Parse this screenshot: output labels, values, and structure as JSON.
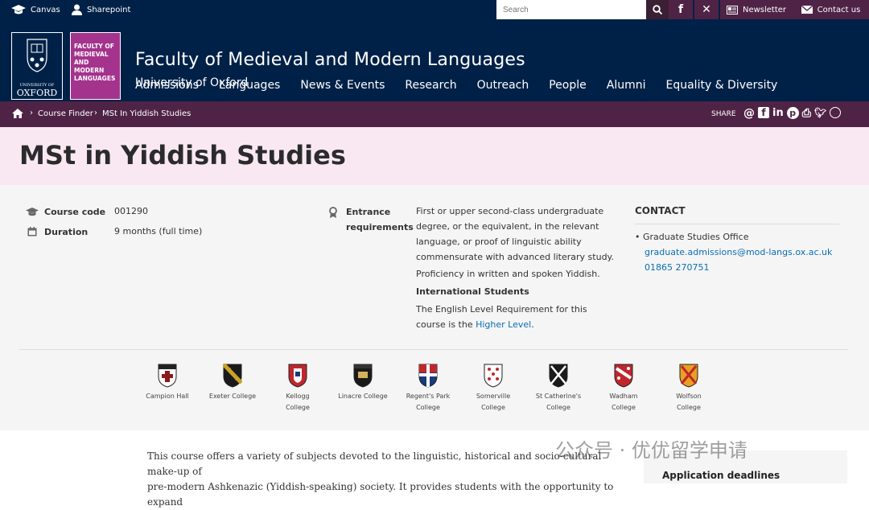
{
  "topbar": {
    "canvas": "Canvas",
    "sharepoint": "Sharepoint",
    "search_placeholder": "Search",
    "newsletter": "Newsletter",
    "contact": "Contact us"
  },
  "header": {
    "faculty_logo_text": "FACULTY OF MEDIEVAL AND MODERN LANGUAGES",
    "ox_logo_text_small": "UNIVERSITY OF",
    "ox_logo_text": "OXFORD",
    "title": "Faculty of Medieval and Modern Languages",
    "subtitle": "University of Oxford",
    "nav": [
      "Admissions",
      "Languages",
      "News & Events",
      "Research",
      "Outreach",
      "People",
      "Alumni",
      "Equality & Diversity"
    ]
  },
  "breadcrumb": {
    "items": [
      "Course Finder",
      "MSt In Yiddish Studies"
    ],
    "share_label": "SHARE"
  },
  "page": {
    "title": "MSt in Yiddish Studies"
  },
  "course": {
    "code_label": "Course code",
    "code_value": "001290",
    "duration_label": "Duration",
    "duration_value": "9 months (full time)",
    "entrance_label_1": "Entrance",
    "entrance_label_2": "requirements",
    "entrance_text": "First or upper second-class undergraduate degree, or the equivalent, in the relevant language, or proof of linguistic ability commensurate with advanced literary study.",
    "proficiency": "Proficiency in written and spoken Yiddish.",
    "intl_heading": "International Students",
    "intl_text": "The English Level Requirement for this course is the",
    "intl_link": "Higher Level",
    "intl_end": "."
  },
  "contact": {
    "heading": "CONTACT",
    "office": "Graduate Studies Office",
    "email": "graduate.admissions@mod-langs.ox.ac.uk",
    "phone": "01865 270751"
  },
  "colleges": [
    {
      "name_1": "Campion Hall",
      "name_2": ""
    },
    {
      "name_1": "Exeter College",
      "name_2": ""
    },
    {
      "name_1": "Kellogg",
      "name_2": "College"
    },
    {
      "name_1": "Linacre College",
      "name_2": ""
    },
    {
      "name_1": "Regent's Park",
      "name_2": "College"
    },
    {
      "name_1": "Somerville",
      "name_2": "College"
    },
    {
      "name_1": "St Catherine's",
      "name_2": "College"
    },
    {
      "name_1": "Wadham",
      "name_2": "College"
    },
    {
      "name_1": "Wolfson",
      "name_2": "College"
    }
  ],
  "body": {
    "intro_line_1": "This course offers a variety of subjects devoted to the linguistic, historical and socio-cultural make-up of",
    "intro_line_2": "pre-modern Ashkenazic (Yiddish-speaking) society. It provides students with the opportunity to expand"
  },
  "sidebar": {
    "deadlines_heading": "Application deadlines"
  },
  "watermark": "公众号 · 优优留学申请",
  "colors": {
    "navy": "#002147",
    "plum": "#4f2346",
    "faculty_magenta": "#a4338d",
    "hero_pink": "#f9e8f2",
    "link_blue": "#0a6eb4"
  }
}
